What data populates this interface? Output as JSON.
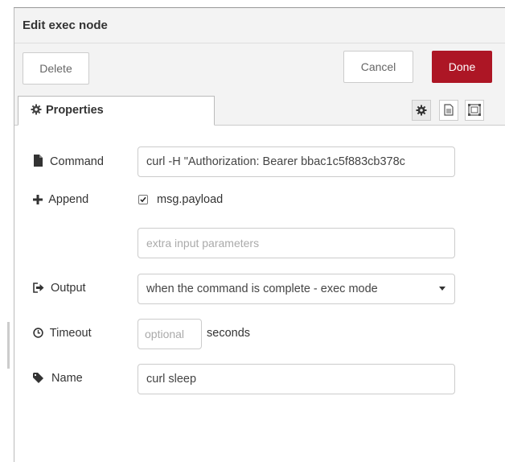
{
  "header": {
    "title": "Edit exec node"
  },
  "toolbar": {
    "delete_label": "Delete",
    "cancel_label": "Cancel",
    "done_label": "Done"
  },
  "tabs": {
    "properties_label": "Properties",
    "icons": [
      "gear-icon",
      "description-icon",
      "appearance-icon"
    ]
  },
  "form": {
    "command": {
      "label": "Command",
      "value": "curl -H \"Authorization: Bearer bbac1c5f883cb378c"
    },
    "append": {
      "label": "Append",
      "checkbox_checked": true,
      "checkbox_label": "msg.payload",
      "extra_placeholder": "extra input parameters"
    },
    "output": {
      "label": "Output",
      "selected": "when the command is complete - exec mode"
    },
    "timeout": {
      "label": "Timeout",
      "placeholder": "optional",
      "suffix": "seconds"
    },
    "name": {
      "label": "Name",
      "value": "curl sleep"
    }
  },
  "colors": {
    "done_button": "#ad1625",
    "panel_bg": "#f3f3f3"
  }
}
